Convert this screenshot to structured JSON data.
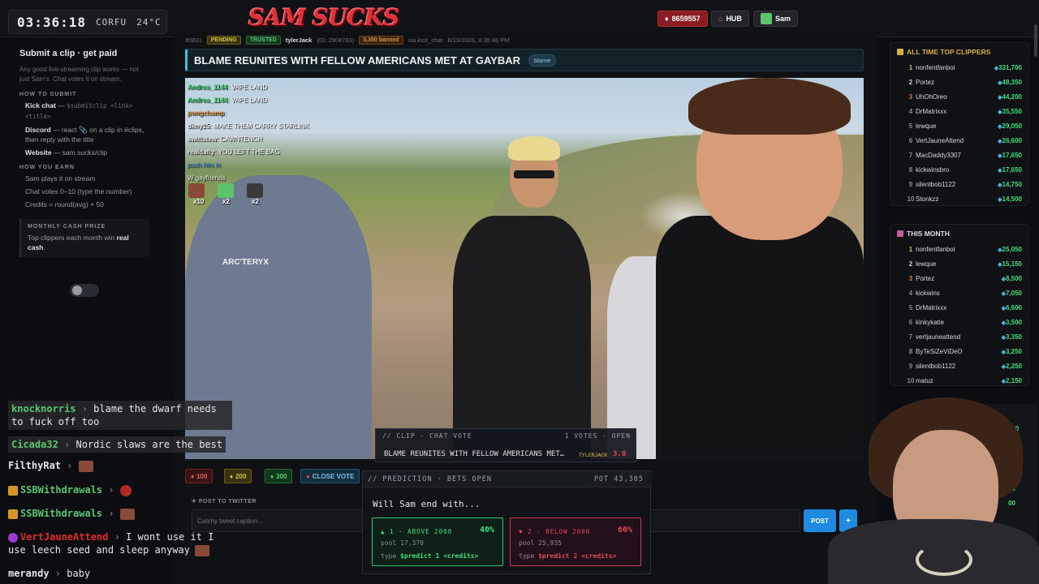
{
  "topbar": {
    "clock_time": "03:36:18",
    "clock_city": "CORFU",
    "clock_temp": "24°C",
    "logo": "SAM SUCKS",
    "gem_count": "8659557",
    "hub_label": "HUB",
    "user_label": "Sam"
  },
  "sidebar": {
    "title": "Submit a clip · get paid",
    "intro": "Any good live-streaming clip works — not just Sam's. Chat votes it on stream.",
    "how_to_submit_head": "HOW TO SUBMIT",
    "kick_label": "Kick chat",
    "kick_cmd": "$submitclip <link> <title>",
    "discord_label": "Discord",
    "discord_text": "— react 📎 on a clip in #clips, then reply with the title",
    "website_label": "Website",
    "website_text": "— sam.sucks/clip",
    "how_you_earn_head": "HOW YOU EARN",
    "earn_1": "Sam plays it on stream",
    "earn_2": "Chat votes 0–10 (type the number)",
    "earn_3": "Credits = round(avg) × 50",
    "prize_head": "MONTHLY CASH PRIZE",
    "prize_text_1": "Top clippers each month win",
    "prize_text_bold": "real cash",
    "prize_text_2": "."
  },
  "chat": [
    {
      "user": "knocknorris",
      "user_color": "#56c870",
      "text": "blame the dwarf needs to fuck off too"
    },
    {
      "user": "Cicada32",
      "user_color": "#56c870",
      "text": "Nordic slaws are the best"
    },
    {
      "user": "FilthyRat",
      "user_color": "#e6e6e6",
      "text": ""
    },
    {
      "user": "SSBWithdrawals",
      "user_color": "#56c870",
      "text": ""
    },
    {
      "user": "SSBWithdrawals",
      "user_color": "#56c870",
      "text": ""
    },
    {
      "user": "VertJauneAttend",
      "user_color": "#e02a2a",
      "text": "I wont use it I use leech seed and sleep anyway"
    },
    {
      "user": "merandy",
      "user_color": "#e6e6e6",
      "text": "baby"
    }
  ],
  "clip": {
    "id": "#0831",
    "status_badge": "PENDING",
    "trust_badge": "TRUSTED",
    "submitter": "tylerJack",
    "submitter_id": "(ID: 2904783)",
    "banned_badge": "3,350 banned",
    "via": "via kick_chat",
    "date": "8/19/2026, 8:35:48 PM",
    "title": "BLAME REUNITES WITH FELLOW AMERICANS MET AT GAYBAR",
    "tag": "blame"
  },
  "video_chat": [
    {
      "user": "Andrea_1144",
      "text": "VAPE LAND",
      "color": "#3ad86a"
    },
    {
      "user": "Andrea_1144",
      "text": "VAPE LAND",
      "color": "#3ad86a"
    },
    {
      "user": "pongchamp",
      "text": "",
      "color": "#d89040"
    },
    {
      "user": "dkny25",
      "text": "MAKE THEM CARRY STARLINK",
      "color": "#e8e8e8"
    },
    {
      "user": "swiftstew",
      "text": "CAWNTENCH",
      "color": "#e8e8e8"
    },
    {
      "user": "realdafty",
      "text": "YOU LEFT THE BAG",
      "color": "#e8e8e8"
    },
    {
      "user": "",
      "text": "push him in",
      "color": "#3a8ae0"
    },
    {
      "user": "",
      "text": "W gayfriends",
      "color": "#e8e8e8"
    }
  ],
  "video_emotes": [
    "x10",
    "x2",
    "x2"
  ],
  "clip_vote": {
    "head_left": "// CLIP · CHAT VOTE",
    "votes": "1 VOTES · OPEN",
    "title": "BLAME REUNITES WITH FELLOW AMERICANS MET…",
    "user": "TYLERJACK",
    "score": "3.0"
  },
  "vote_buttons": {
    "b100": "100",
    "b200": "200",
    "b300": "300",
    "close": "CLOSE VOTE"
  },
  "tweet": {
    "head": "POST TO TWITTER",
    "placeholder": "Catchy tweet caption...",
    "post": "POST",
    "plus": "+"
  },
  "prediction": {
    "head_left": "// PREDICTION · BETS OPEN",
    "pot": "POT 43,305",
    "question": "Will Sam end with...",
    "opt_a_name": "▲ 1 · ABOVE 2000",
    "opt_a_pct": "40%",
    "opt_a_pool": "pool 17,370",
    "opt_a_type": "type",
    "opt_a_cmd": "$predict 1 <credits>",
    "opt_b_name": "▼ 2 · BELOW 2000",
    "opt_b_pct": "60%",
    "opt_b_pool": "pool 25,935",
    "opt_b_type": "type",
    "opt_b_cmd": "$predict 2 <credits>"
  },
  "leaderboard_all": {
    "title": "ALL TIME TOP CLIPPERS",
    "rows": [
      {
        "rank": "1",
        "name": "nonfentfanboi",
        "score": "331,700"
      },
      {
        "rank": "2",
        "name": "Portez",
        "score": "48,350"
      },
      {
        "rank": "3",
        "name": "UhOhOreo",
        "score": "44,200"
      },
      {
        "rank": "4",
        "name": "DrMatrixxx",
        "score": "35,550"
      },
      {
        "rank": "5",
        "name": "lewque",
        "score": "29,050"
      },
      {
        "rank": "6",
        "name": "VertJauneAttend",
        "score": "26,600"
      },
      {
        "rank": "7",
        "name": "MacDaddy3307",
        "score": "17,650"
      },
      {
        "rank": "8",
        "name": "kickwinsbro",
        "score": "17,650"
      },
      {
        "rank": "9",
        "name": "silentbob1122",
        "score": "14,750"
      },
      {
        "rank": "10",
        "name": "Stonkzz",
        "score": "14,500"
      }
    ]
  },
  "leaderboard_month": {
    "title": "THIS MONTH",
    "rows": [
      {
        "rank": "1",
        "name": "nonfentfanboi",
        "score": "25,050"
      },
      {
        "rank": "2",
        "name": "lewque",
        "score": "15,150"
      },
      {
        "rank": "3",
        "name": "Portez",
        "score": "8,500"
      },
      {
        "rank": "4",
        "name": "kickwins",
        "score": "7,050"
      },
      {
        "rank": "5",
        "name": "DrMatrixxx",
        "score": "6,600"
      },
      {
        "rank": "6",
        "name": "kinkykatie",
        "score": "3,500"
      },
      {
        "rank": "7",
        "name": "vertjauneattend",
        "score": "3,350"
      },
      {
        "rank": "8",
        "name": "ByTeSiZeViDeO",
        "score": "3,250"
      },
      {
        "rank": "9",
        "name": "silentbob1122",
        "score": "2,250"
      },
      {
        "rank": "10",
        "name": "matuz",
        "score": "2,150"
      }
    ]
  },
  "partial_scores": [
    "600",
    "450",
    "350",
    "50",
    "00",
    "00"
  ],
  "colors": {
    "accent_cyan": "#30c8d8",
    "gold": "#d8b040",
    "green": "#3ae07a",
    "red": "#e04a5a",
    "brand_red": "#e0303a"
  }
}
